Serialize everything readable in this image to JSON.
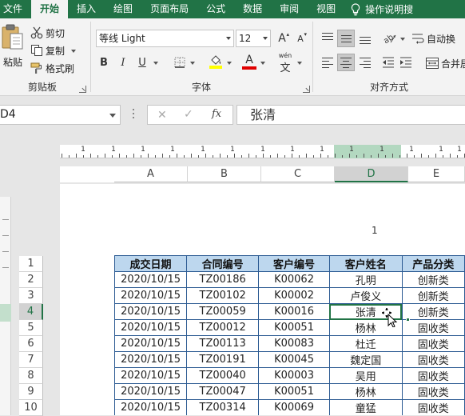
{
  "menu": {
    "tabs": [
      "文件",
      "开始",
      "插入",
      "绘图",
      "页面布局",
      "公式",
      "数据",
      "审阅",
      "视图"
    ],
    "active_index": 1,
    "tell_me": "操作说明搜"
  },
  "ribbon": {
    "clipboard": {
      "paste": "粘贴",
      "cut": "剪切",
      "copy": "复制",
      "format_painter": "格式刷",
      "group_label": "剪贴板"
    },
    "font": {
      "font_name": "等线 Light",
      "font_size": "12",
      "bold": "B",
      "italic": "I",
      "underline": "U",
      "grow": "A",
      "shrink": "A",
      "font_color_letter": "A",
      "phonetic_top": "wén",
      "phonetic_bottom": "文",
      "group_label": "字体"
    },
    "alignment": {
      "wrap_text": "自动换",
      "merge": "合并居",
      "group_label": "对齐方式"
    }
  },
  "formula_bar": {
    "name_box": "D4",
    "fx": "fx",
    "value": "张清"
  },
  "sheet": {
    "columns": [
      "A",
      "B",
      "C",
      "D",
      "E"
    ],
    "selected_column": "D",
    "ruler_numbers": [
      "1",
      "1",
      "1",
      "1",
      "1",
      "1",
      "1",
      "1",
      "1",
      "1",
      "1",
      "1",
      "1",
      "1"
    ],
    "rows": [
      "1",
      "2",
      "3",
      "4",
      "5",
      "6",
      "7",
      "8",
      "9",
      "10"
    ],
    "selected_row": "4",
    "page_number": "1",
    "header": [
      "成交日期",
      "合同编号",
      "客户编号",
      "客户姓名",
      "产品分类"
    ],
    "data": [
      [
        "2020/10/15",
        "TZ00186",
        "K00062",
        "孔明",
        "创新类"
      ],
      [
        "2020/10/15",
        "TZ00102",
        "K00002",
        "卢俊义",
        "创新类"
      ],
      [
        "2020/10/15",
        "TZ00059",
        "K00016",
        "张清",
        "创新类"
      ],
      [
        "2020/10/15",
        "TZ00012",
        "K00051",
        "杨林",
        "固收类"
      ],
      [
        "2020/10/15",
        "TZ00113",
        "K00083",
        "杜迁",
        "固收类"
      ],
      [
        "2020/10/15",
        "TZ00191",
        "K00045",
        "魏定国",
        "固收类"
      ],
      [
        "2020/10/15",
        "TZ00040",
        "K00003",
        "吴用",
        "固收类"
      ],
      [
        "2020/10/15",
        "TZ00047",
        "K00051",
        "杨林",
        "固收类"
      ],
      [
        "2020/10/15",
        "TZ00314",
        "K00069",
        "童猛",
        "固收类"
      ]
    ]
  },
  "colors": {
    "excel_green": "#217346",
    "header_fill": "#bdd7ee",
    "table_border": "#2b5a92"
  }
}
